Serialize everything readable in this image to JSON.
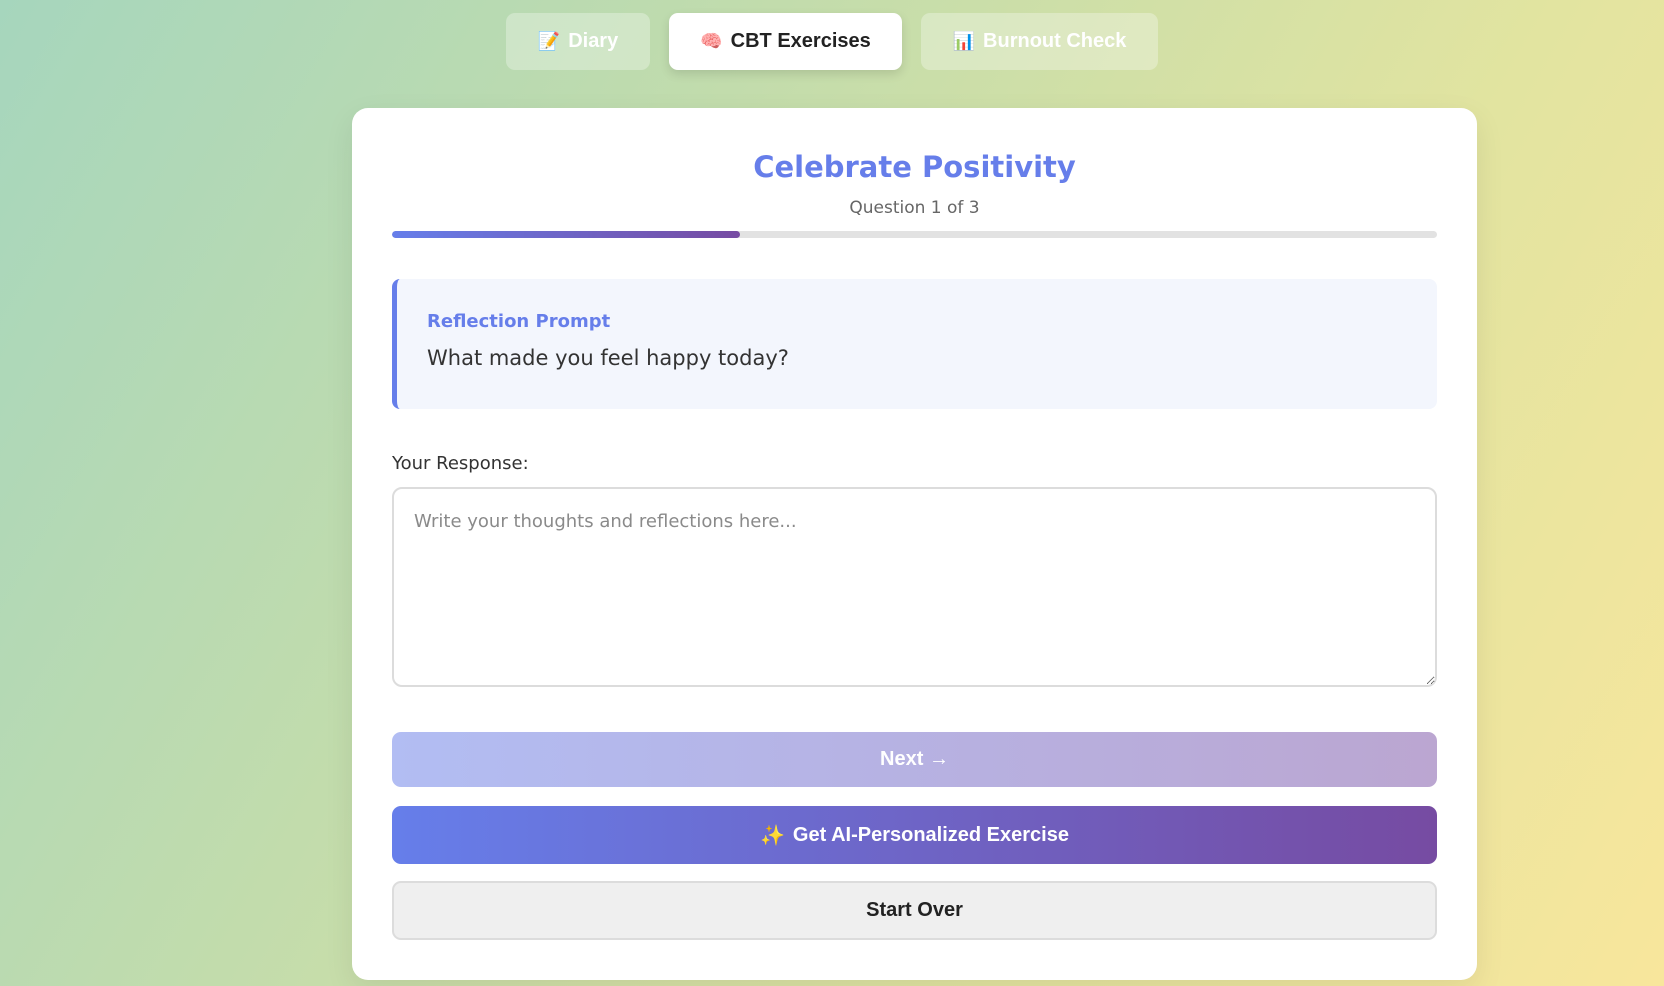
{
  "tabs": [
    {
      "icon": "📝",
      "label": "Diary",
      "active": false
    },
    {
      "icon": "🧠",
      "label": "CBT Exercises",
      "active": true
    },
    {
      "icon": "📊",
      "label": "Burnout Check",
      "active": false
    }
  ],
  "exercise": {
    "title": "Celebrate Positivity",
    "question_counter": "Question 1 of 3",
    "progress_fraction": 0.333
  },
  "prompt": {
    "label": "Reflection Prompt",
    "text": "What made you feel happy today?"
  },
  "response": {
    "label": "Your Response:",
    "value": "",
    "placeholder": "Write your thoughts and reflections here..."
  },
  "buttons": {
    "next_label": "Next →",
    "ai_icon": "✨",
    "ai_label": "Get AI-Personalized Exercise",
    "reset_label": "Start Over"
  },
  "colors": {
    "accent": "#667eea",
    "accent_secondary": "#764ba2"
  }
}
